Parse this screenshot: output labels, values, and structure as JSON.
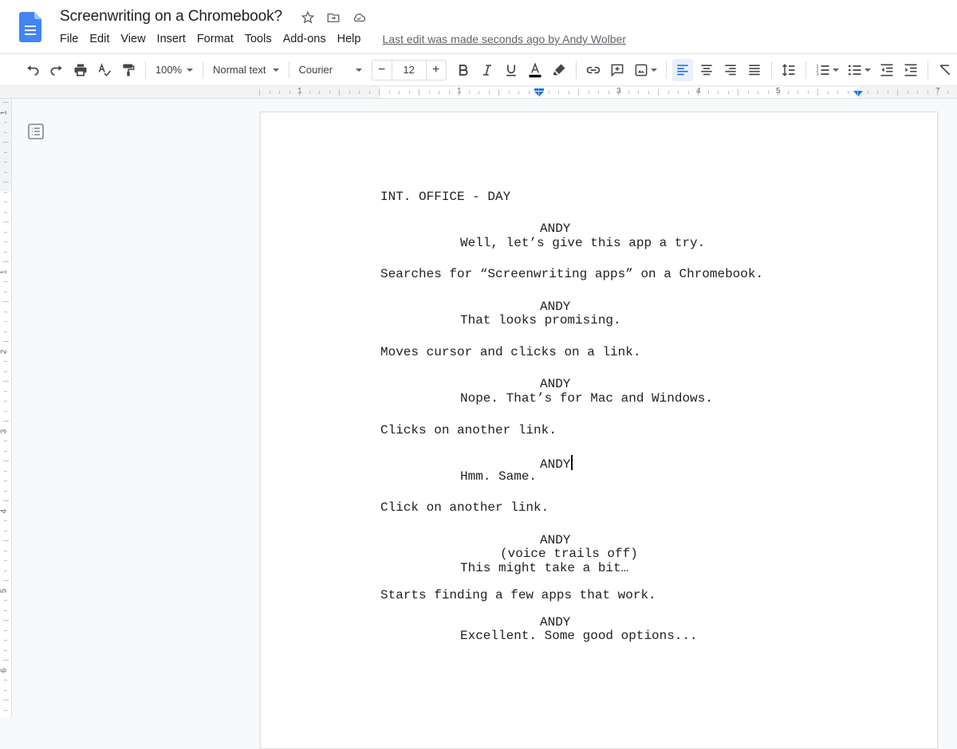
{
  "app": {
    "doc_title": "Screenwriting on a Chromebook?",
    "title_icons": [
      "star-icon",
      "move-to-folder-icon",
      "cloud-saved-icon"
    ],
    "menu": [
      "File",
      "Edit",
      "View",
      "Insert",
      "Format",
      "Tools",
      "Add-ons",
      "Help"
    ],
    "last_edit": "Last edit was made seconds ago by Andy Wolber"
  },
  "toolbar": {
    "zoom": "100%",
    "style": "Normal text",
    "font": "Courier",
    "font_size": "12",
    "decrease_label": "−",
    "increase_label": "+",
    "text_color": "#000000",
    "active_alignment": "left"
  },
  "ruler": {
    "horizontal_numbers": [
      "1",
      "1",
      "3",
      "4",
      "5",
      "7"
    ],
    "vertical_numbers": [
      "1",
      "1",
      "2",
      "3",
      "4",
      "5",
      "6"
    ]
  },
  "document": {
    "lines": [
      {
        "type": "scene-heading",
        "text": "INT. OFFICE - DAY"
      },
      {
        "type": "character",
        "text": "ANDY"
      },
      {
        "type": "dialogue",
        "text": "Well, let’s give this app a try."
      },
      {
        "type": "action",
        "text": "Searches for “Screenwriting apps” on a Chromebook."
      },
      {
        "type": "character",
        "text": "ANDY"
      },
      {
        "type": "dialogue",
        "text": "That looks promising."
      },
      {
        "type": "action",
        "text": "Moves cursor and clicks on a link."
      },
      {
        "type": "character",
        "text": "ANDY"
      },
      {
        "type": "dialogue",
        "text": "Nope. That’s for Mac and Windows."
      },
      {
        "type": "action",
        "text": "Clicks on another link."
      },
      {
        "type": "character",
        "text": "ANDY",
        "cursor": true
      },
      {
        "type": "dialogue",
        "text": "Hmm. Same."
      },
      {
        "type": "action",
        "text": "Click on another link."
      },
      {
        "type": "character",
        "text": "ANDY"
      },
      {
        "type": "parenthetical",
        "text": "(voice trails off)"
      },
      {
        "type": "dialogue",
        "text": "This might take a bit…"
      },
      {
        "type": "action",
        "text": "Starts finding a few apps that work."
      },
      {
        "type": "character",
        "text": "ANDY"
      },
      {
        "type": "dialogue",
        "text": "Excellent. Some good options..."
      }
    ]
  }
}
